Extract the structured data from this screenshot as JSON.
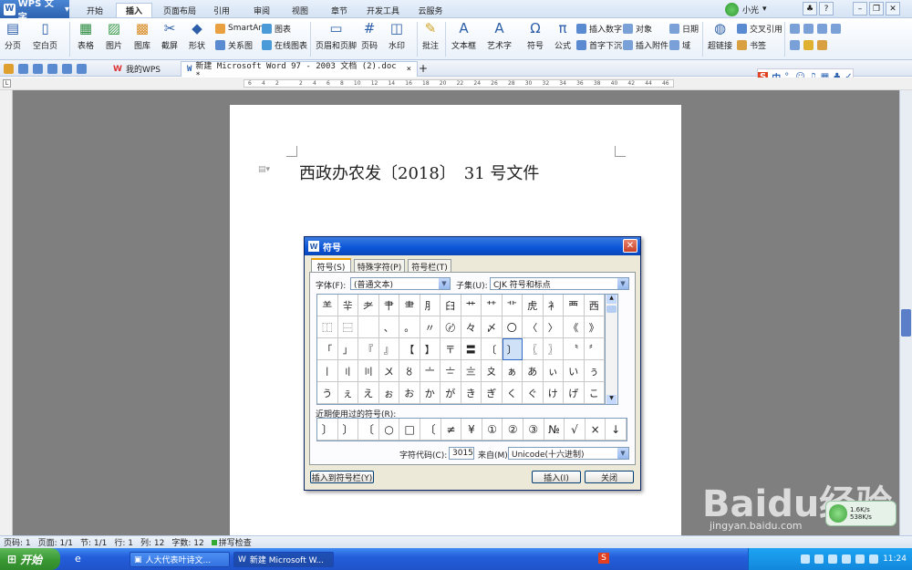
{
  "app": {
    "name": "WPS 文字"
  },
  "menu": {
    "tabs": [
      "开始",
      "插入",
      "页面布局",
      "引用",
      "审阅",
      "视图",
      "章节",
      "开发工具",
      "云服务"
    ],
    "active": "插入"
  },
  "user": {
    "name": "小光"
  },
  "ribbon": {
    "page_split": "分页",
    "blank_page": "空白页",
    "table": "表格",
    "picture": "图片",
    "gallery": "图库",
    "screenshot": "截屏",
    "shape": "形状",
    "smartart": "SmartArt",
    "chart": "图表",
    "relation_chart": "关系图",
    "online_chart": "在线图表",
    "header_footer": "页眉和页脚",
    "page_number": "页码",
    "watermark": "水印",
    "comment": "批注",
    "textbox": "文本框",
    "wordart": "艺术字",
    "symbol": "符号",
    "formula": "公式",
    "insert_number": "插入数字",
    "object": "对象",
    "date": "日期",
    "drop_cap": "首字下沉",
    "attachment": "插入附件",
    "field": "域",
    "hyperlink": "超链接",
    "cross_ref": "交叉引用",
    "bookmark": "书签"
  },
  "tabs": {
    "mywps": "我的WPS",
    "doc": "新建 Microsoft Word 97 - 2003 文档 (2).doc *"
  },
  "ruler": {
    "marks": [
      "6",
      "4",
      "2",
      "",
      "2",
      "4",
      "6",
      "8",
      "10",
      "12",
      "14",
      "16",
      "18",
      "20",
      "22",
      "24",
      "26",
      "28",
      "30",
      "32",
      "34",
      "36",
      "38",
      "40",
      "42",
      "44",
      "46"
    ]
  },
  "document": {
    "title": "西政办农发〔2018〕　31 号文件"
  },
  "dialog": {
    "title": "符号",
    "tabs": [
      "符号(S)",
      "特殊字符(P)",
      "符号栏(T)"
    ],
    "font_label": "字体(F):",
    "font_value": "(普通文本)",
    "subset_label": "子集(U):",
    "subset_value": "CJK 符号和标点",
    "grid": [
      [
        "⺷",
        "⺸",
        "⺹",
        "⺺",
        "⺻",
        "⺼",
        "⺽",
        "⺾",
        "⺿",
        "⻀",
        "⻁",
        "⻂",
        "⻃",
        "⻄"
      ],
      [
        "⿰",
        "⿱",
        "　",
        "、",
        "。",
        "〃",
        "〄",
        "々",
        "〆",
        "〇",
        "〈",
        "〉",
        "《",
        "》"
      ],
      [
        "「",
        "」",
        "『",
        "』",
        "【",
        "】",
        "〒",
        "〓",
        "〔",
        "〕",
        "〖",
        "〗",
        "〝",
        "〞"
      ],
      [
        "〡",
        "〢",
        "〣",
        "〤",
        "〥",
        "〦",
        "〧",
        "〨",
        "〩",
        "ぁ",
        "あ",
        "ぃ",
        "い",
        "ぅ"
      ],
      [
        "う",
        "ぇ",
        "え",
        "ぉ",
        "お",
        "か",
        "が",
        "き",
        "ぎ",
        "く",
        "ぐ",
        "け",
        "げ",
        "こ"
      ]
    ],
    "recent_label": "近期使用过的符号(R):",
    "recent": [
      "〕",
      "〕",
      "〔",
      "○",
      "□",
      "〔",
      "≠",
      "¥",
      "①",
      "②",
      "③",
      "№",
      "√",
      "×",
      "↓"
    ],
    "code_label": "字符代码(C):",
    "code_value": "3015",
    "from_label": "来自(M):",
    "from_value": "Unicode(十六进制)",
    "insert_to_bar": "插入到符号栏(Y)",
    "insert": "插入(I)",
    "close": "关闭"
  },
  "status": {
    "page": "页码: 1",
    "pages": "页面: 1/1",
    "section": "节: 1/1",
    "row": "行: 1",
    "col": "列: 12",
    "words": "字数: 12",
    "spellcheck": "拼写检查"
  },
  "taskbar": {
    "start": "开始",
    "tasks": [
      "人大代表叶诗文...",
      "新建 Microsoft W..."
    ],
    "time": "11:24"
  },
  "netwidget": {
    "up": "1.6K/s",
    "down": "538K/s"
  },
  "watermark": {
    "logo": "Baidu经验",
    "url": "jingyan.baidu.com"
  }
}
